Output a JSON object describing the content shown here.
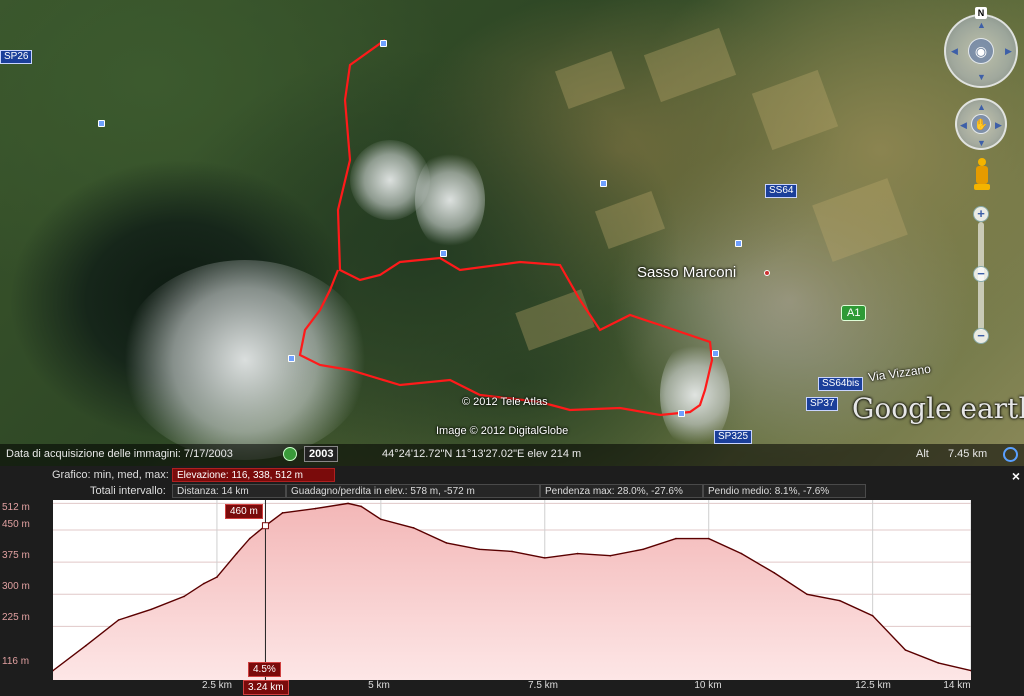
{
  "map": {
    "place_label": "Sasso Marconi",
    "road_labels": [
      "SP26",
      "SS64",
      "SS64bis",
      "SP37",
      "SP325",
      "Via Vizzano"
    ],
    "a1_label": "A1",
    "copyright_tele_atlas": "© 2012 Tele Atlas",
    "copyright_digitalglobe": "Image © 2012 DigitalGlobe",
    "brand": "Google earth",
    "compass_north": "N"
  },
  "status": {
    "imagery_date": "Data di acquisizione delle immagini: 7/17/2003",
    "year": "2003",
    "coordinates": "44°24'12.72\"N  11°13'27.02\"E  elev  214 m",
    "alt_label": "Alt",
    "alt_value": "7.45 km"
  },
  "panel": {
    "graph_label": "Grafico: min, med, max:",
    "elevation": "Elevazione: 116, 338, 512 m",
    "totals_label": "Totali intervallo:",
    "distance": "Distanza: 14 km",
    "gain_loss": "Guadagno/perdita in elev.: 578 m, -572 m",
    "max_slope": "Pendenza max: 28.0%, -27.6%",
    "avg_slope": "Pendio medio: 8.1%, -7.6%",
    "close": "×",
    "cursor_elev": "460 m",
    "cursor_slope": "4.5%",
    "cursor_dist": "3.24 km"
  },
  "chart_data": {
    "type": "area",
    "xlabel": "",
    "ylabel": "",
    "ylim": [
      116,
      512
    ],
    "xlim": [
      0,
      14
    ],
    "ytick_labels": [
      "512 m",
      "450 m",
      "375 m",
      "300 m",
      "225 m",
      "116 m"
    ],
    "ytick_values": [
      512,
      450,
      375,
      300,
      225,
      116
    ],
    "xtick_labels": [
      "2.5 km",
      "5 km",
      "7.5 km",
      "10 km",
      "12.5 km",
      "14 km"
    ],
    "xtick_values": [
      2.5,
      5,
      7.5,
      10,
      12.5,
      14
    ],
    "x": [
      0,
      0.5,
      1,
      1.5,
      2,
      2.3,
      2.5,
      2.8,
      3,
      3.24,
      3.5,
      4,
      4.5,
      4.7,
      5,
      5.5,
      6,
      6.5,
      7,
      7.5,
      8,
      8.5,
      9,
      9.5,
      10,
      10.5,
      11,
      11.5,
      12,
      12.5,
      13,
      13.5,
      14
    ],
    "y": [
      122,
      180,
      240,
      265,
      295,
      325,
      340,
      395,
      430,
      460,
      490,
      500,
      512,
      505,
      475,
      455,
      420,
      405,
      400,
      385,
      395,
      390,
      405,
      430,
      430,
      395,
      350,
      300,
      285,
      250,
      170,
      140,
      122
    ],
    "colors": {
      "line": "#5a0000",
      "fill_top": "#f3b7b7",
      "fill_bottom": "#fde6e6",
      "cursor": "#7a0b0b"
    }
  }
}
